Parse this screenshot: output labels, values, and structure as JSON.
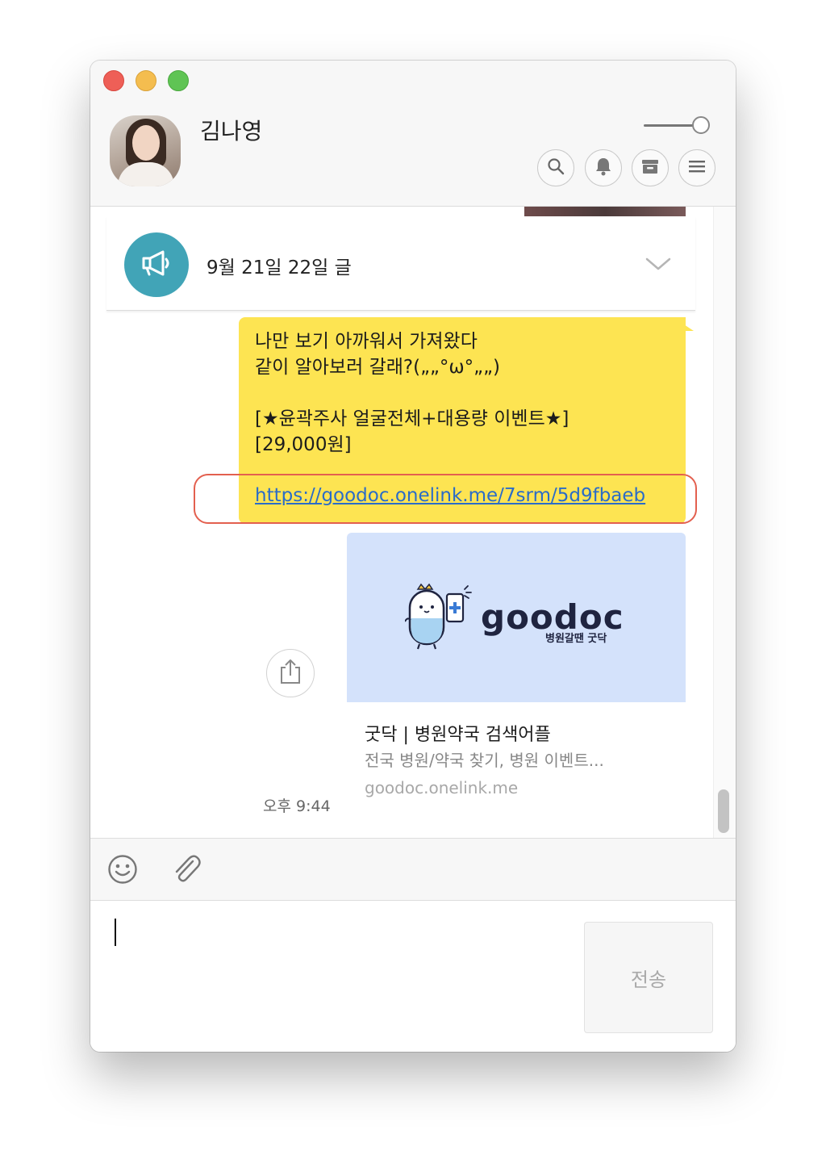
{
  "header": {
    "contact_name": "김나영"
  },
  "notice": {
    "text": "9월 21일 22일 글"
  },
  "message": {
    "lines": [
      "나만 보기 아까워서 가져왔다",
      "같이 알아보러 갈래?(„„°ω°„„)",
      "",
      "[★윤곽주사 얼굴전체+대용량 이벤트★]",
      "[29,000원]"
    ],
    "link": "https://goodoc.onelink.me/7srm/5d9fbaeb",
    "time": "오후 9:44"
  },
  "link_preview": {
    "brand": "goodoc",
    "tagline": "병원갈땐 굿닥",
    "title": "굿닥 | 병원약국 검색어플",
    "description": "전국 병원/약국 찾기, 병원 이벤트...",
    "domain": "goodoc.onelink.me"
  },
  "composer": {
    "send_label": "전송",
    "input_value": ""
  },
  "colors": {
    "bubble": "#fde452",
    "notice_icon": "#41a4b7",
    "link": "#2a6cc8",
    "highlight": "#e3604f",
    "preview_bg": "#d4e2fb"
  },
  "icons": {
    "header": [
      "search-icon",
      "bell-icon",
      "archive-icon",
      "menu-icon"
    ],
    "notice": "megaphone-icon",
    "toolbar": [
      "emoji-icon",
      "paperclip-icon"
    ],
    "share": "share-icon"
  }
}
